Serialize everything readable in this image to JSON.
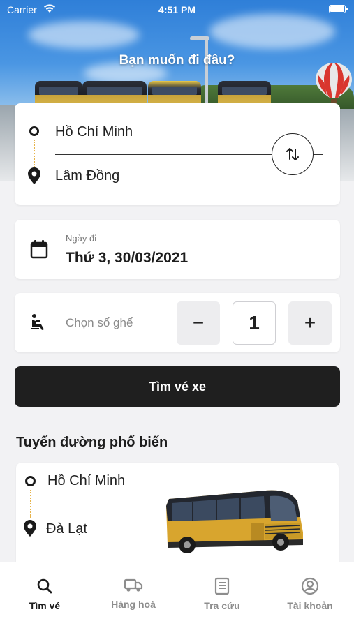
{
  "status_bar": {
    "carrier": "Carrier",
    "time": "4:51 PM"
  },
  "hero": {
    "title": "Bạn muốn đi đâu?"
  },
  "route": {
    "origin": "Hồ Chí Minh",
    "destination": "Lâm Đồng"
  },
  "date": {
    "label": "Ngày đi",
    "value": "Thứ 3, 30/03/2021"
  },
  "seats": {
    "placeholder": "Chọn số ghế",
    "minus": "−",
    "quantity": "1",
    "plus": "+"
  },
  "search_button": "Tìm vé xe",
  "popular": {
    "title": "Tuyến đường phổ biến",
    "routes": [
      {
        "from": "Hồ Chí Minh",
        "to": "Đà Lạt"
      }
    ]
  },
  "tabs": [
    {
      "label": "Tìm vé",
      "icon": "search-icon",
      "active": true
    },
    {
      "label": "Hàng hoá",
      "icon": "truck-icon",
      "active": false
    },
    {
      "label": "Tra cứu",
      "icon": "receipt-icon",
      "active": false
    },
    {
      "label": "Tài khoản",
      "icon": "account-icon",
      "active": false
    }
  ]
}
